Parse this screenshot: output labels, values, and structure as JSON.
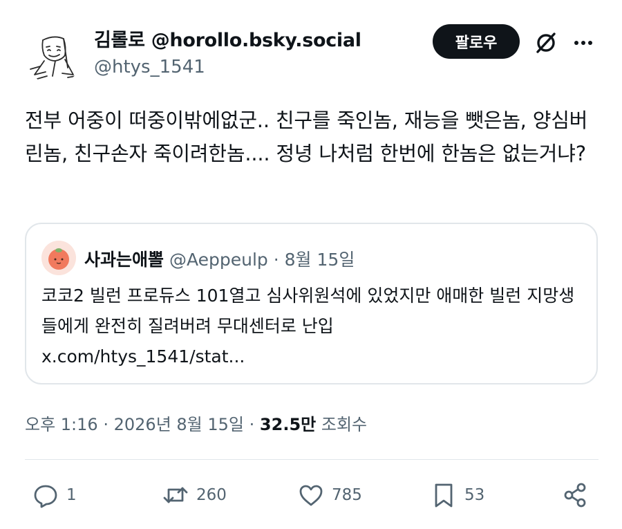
{
  "author": {
    "display_name": "김롤로 @horollo.bsky.social",
    "handle": "@htys_1541",
    "avatar_icon": "sketch-avatar-icon"
  },
  "header_actions": {
    "follow_label": "팔로우",
    "grok_icon": "grok-slash-icon",
    "more_icon": "more-dots-icon"
  },
  "tweet": {
    "text": "전부 어중이 떠중이밖에없군.. 친구를 죽인놈, 재능을 뺏은놈, 양심버린놈, 친구손자 죽이려한놈.... 정녕 나처럼 한번에 한놈은 없는거냐?"
  },
  "quote": {
    "display_name": "사과는애뽈",
    "handle": "@Aeppeulp",
    "separator": "·",
    "date": "8월 15일",
    "text": "코코2 빌런 프로듀스 101열고 심사위원석에 있었지만 애매한 빌런 지망생들에게 완전히 질려버려 무대센터로 난입",
    "link": "x.com/htys_1541/stat..."
  },
  "meta": {
    "time": "오후 1:16",
    "separator": "·",
    "date": "2026년 8월 15일",
    "views_count": "32.5만",
    "views_label": "조회수"
  },
  "actions": {
    "reply_count": "1",
    "retweet_count": "260",
    "like_count": "785",
    "bookmark_count": "53"
  },
  "colors": {
    "text": "#0f1419",
    "secondary": "#536471",
    "border": "#e1e6ea",
    "button_bg": "#0f1419"
  }
}
